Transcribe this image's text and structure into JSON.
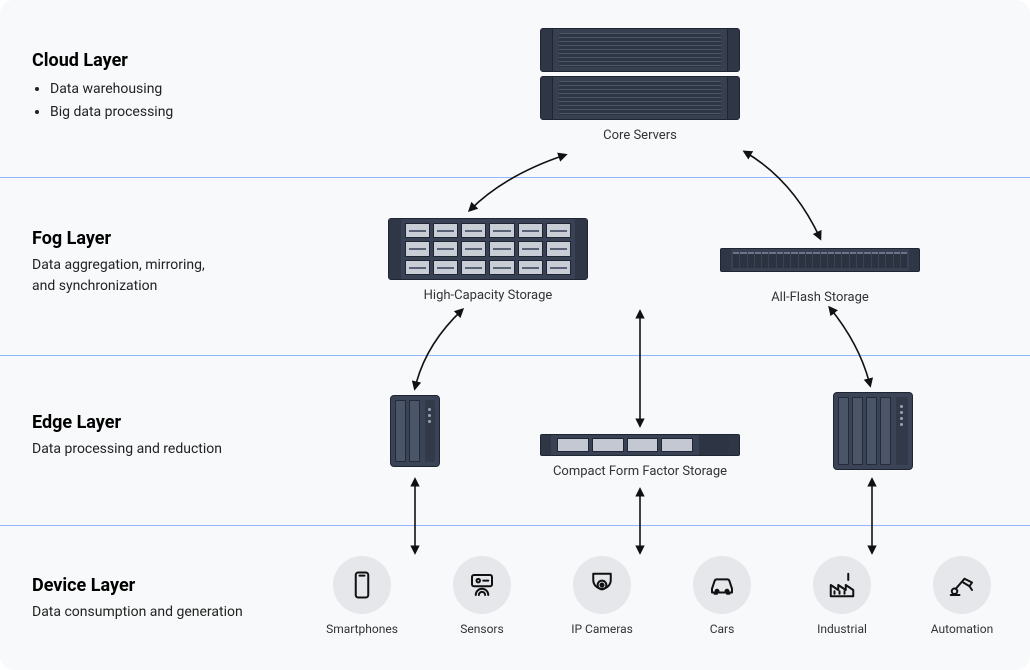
{
  "layers": {
    "cloud": {
      "title": "Cloud Layer",
      "bullets": [
        "Data warehousing",
        "Big data processing"
      ]
    },
    "fog": {
      "title": "Fog Layer",
      "subtitle": "Data aggregation, mirroring,\nand synchronization"
    },
    "edge": {
      "title": "Edge Layer",
      "subtitle": "Data processing and reduction"
    },
    "device": {
      "title": "Device Layer",
      "subtitle": "Data consumption and generation"
    }
  },
  "nodes": {
    "cloud": {
      "core": {
        "label": "Core Servers"
      }
    },
    "fog": {
      "left": {
        "label": "High-Capacity Storage"
      },
      "right": {
        "label": "All-Flash Storage"
      }
    },
    "edge": {
      "mid": {
        "label": "Compact Form Factor Storage"
      }
    }
  },
  "devices": [
    {
      "id": "smartphones",
      "label": "Smartphones"
    },
    {
      "id": "sensors",
      "label": "Sensors"
    },
    {
      "id": "ip-cameras",
      "label": "IP Cameras"
    },
    {
      "id": "cars",
      "label": "Cars"
    },
    {
      "id": "industrial",
      "label": "Industrial"
    },
    {
      "id": "automation",
      "label": "Automation"
    }
  ]
}
